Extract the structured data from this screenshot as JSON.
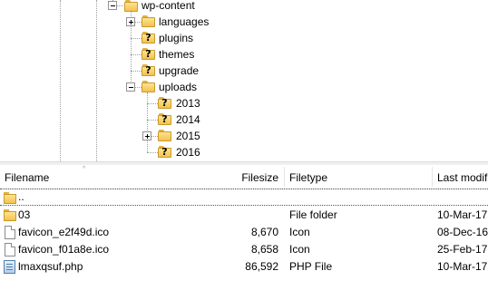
{
  "tree": {
    "items": [
      {
        "label": "wp-content",
        "icon": "folder-open-icon"
      },
      {
        "label": "languages",
        "icon": "folder-icon"
      },
      {
        "label": "plugins",
        "icon": "folder-unknown-icon"
      },
      {
        "label": "themes",
        "icon": "folder-unknown-icon"
      },
      {
        "label": "upgrade",
        "icon": "folder-unknown-icon"
      },
      {
        "label": "uploads",
        "icon": "folder-open-icon"
      },
      {
        "label": "2013",
        "icon": "folder-unknown-icon"
      },
      {
        "label": "2014",
        "icon": "folder-unknown-icon"
      },
      {
        "label": "2015",
        "icon": "folder-icon"
      },
      {
        "label": "2016",
        "icon": "folder-unknown-icon"
      }
    ],
    "question_mark": "?"
  },
  "list": {
    "columns": {
      "filename": "Filename",
      "filesize": "Filesize",
      "filetype": "Filetype",
      "last_modified": "Last modif"
    },
    "sort_indicator": "^",
    "rows": [
      {
        "name": "..",
        "size": "",
        "type": "",
        "modified": "",
        "icon": "parent-folder-icon"
      },
      {
        "name": "03",
        "size": "",
        "type": "File folder",
        "modified": "10-Mar-17",
        "icon": "folder-icon"
      },
      {
        "name": "favicon_e2f49d.ico",
        "size": "8,670",
        "type": "Icon",
        "modified": "08-Dec-16",
        "icon": "file-icon"
      },
      {
        "name": "favicon_f01a8e.ico",
        "size": "8,658",
        "type": "Icon",
        "modified": "25-Feb-17",
        "icon": "file-icon"
      },
      {
        "name": "lmaxqsuf.php",
        "size": "86,592",
        "type": "PHP File",
        "modified": "10-Mar-17",
        "icon": "php-file-icon"
      }
    ]
  },
  "colors": {
    "folder_fill": "#f2c150",
    "tree_line": "#a0a0a0",
    "header_border": "#e5e5e5"
  }
}
